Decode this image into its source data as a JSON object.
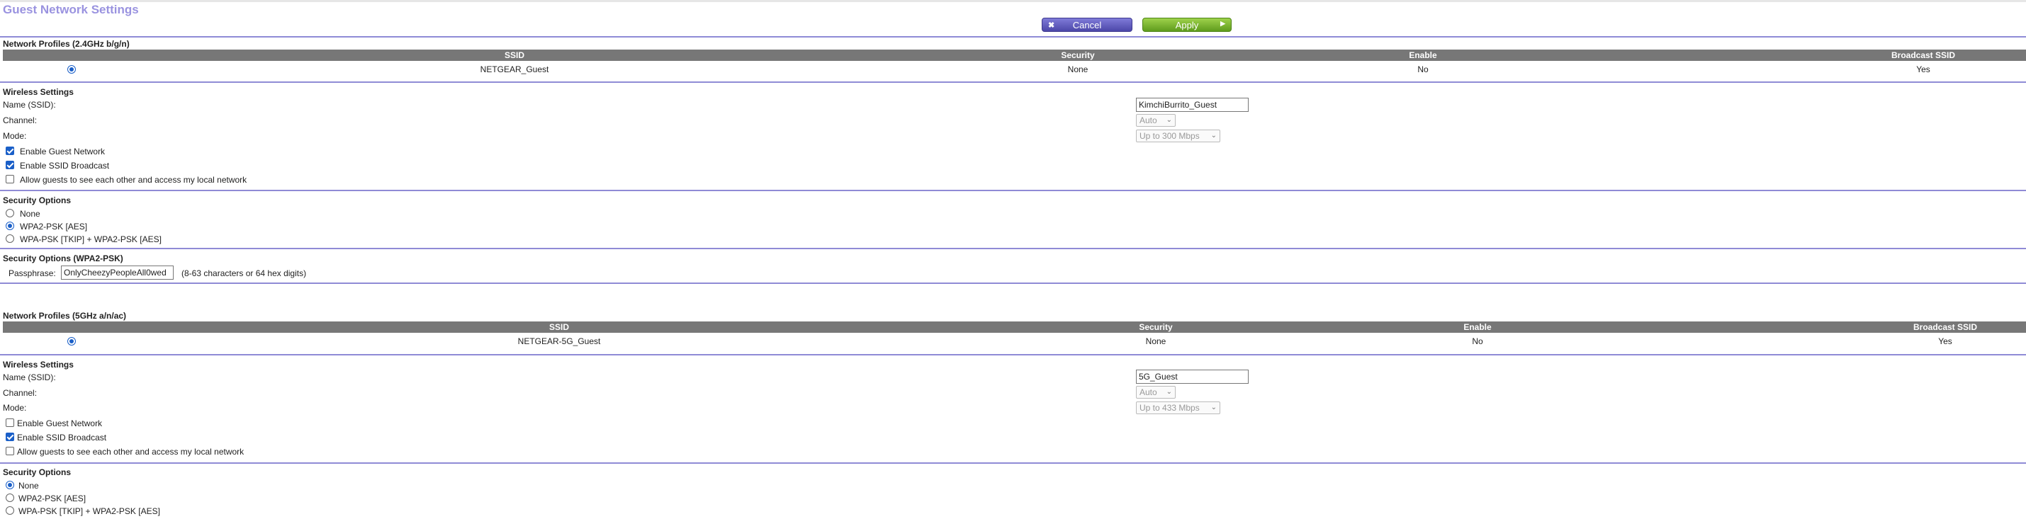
{
  "title": "Guest Network Settings",
  "toolbar": {
    "cancel_label": "Cancel",
    "apply_label": "Apply"
  },
  "table_headers": {
    "ssid": "SSID",
    "security": "Security",
    "enable": "Enable",
    "broadcast": "Broadcast SSID"
  },
  "profiles24": {
    "title": "Network Profiles (2.4GHz b/g/n)",
    "row": {
      "ssid": "NETGEAR_Guest",
      "security": "None",
      "enable": "No",
      "broadcast": "Yes"
    }
  },
  "wireless24": {
    "title": "Wireless Settings",
    "name_label": "Name (SSID):",
    "name_value": "KimchiBurrito_Guest",
    "channel_label": "Channel:",
    "channel_value": "Auto",
    "mode_label": "Mode:",
    "mode_value": "Up to 300 Mbps",
    "enable_guest_label": "Enable Guest Network",
    "enable_ssid_label": "Enable SSID Broadcast",
    "allow_label": "Allow guests to see each other and access my local network"
  },
  "security24": {
    "title": "Security Options",
    "none": "None",
    "wpa2": "WPA2-PSK [AES]",
    "mixed": "WPA-PSK [TKIP] + WPA2-PSK [AES]"
  },
  "wpa2psk": {
    "title": "Security Options (WPA2-PSK)",
    "passphrase_label": "Passphrase:",
    "passphrase_value": "OnlyCheezyPeopleAll0wed",
    "hint": "(8-63 characters or 64 hex digits)"
  },
  "profiles5": {
    "title": "Network Profiles (5GHz a/n/ac)",
    "row": {
      "ssid": "NETGEAR-5G_Guest",
      "security": "None",
      "enable": "No",
      "broadcast": "Yes"
    }
  },
  "wireless5": {
    "title": "Wireless Settings",
    "name_label": "Name (SSID):",
    "name_value": "5G_Guest",
    "channel_label": "Channel:",
    "channel_value": "Auto",
    "mode_label": "Mode:",
    "mode_value": "Up to 433 Mbps",
    "enable_guest_label": "Enable Guest Network",
    "enable_ssid_label": "Enable SSID Broadcast",
    "allow_label": "Allow guests to see each other and access my local network"
  },
  "security5": {
    "title": "Security Options",
    "none": "None",
    "wpa2": "WPA2-PSK [AES]",
    "mixed": "WPA-PSK [TKIP] + WPA2-PSK [AES]"
  },
  "colors": {
    "title": "#9a93e0",
    "divider": "#8f8bd6",
    "table_header": "#777777",
    "cancel": "#5a55b8",
    "apply": "#7bb52f"
  }
}
